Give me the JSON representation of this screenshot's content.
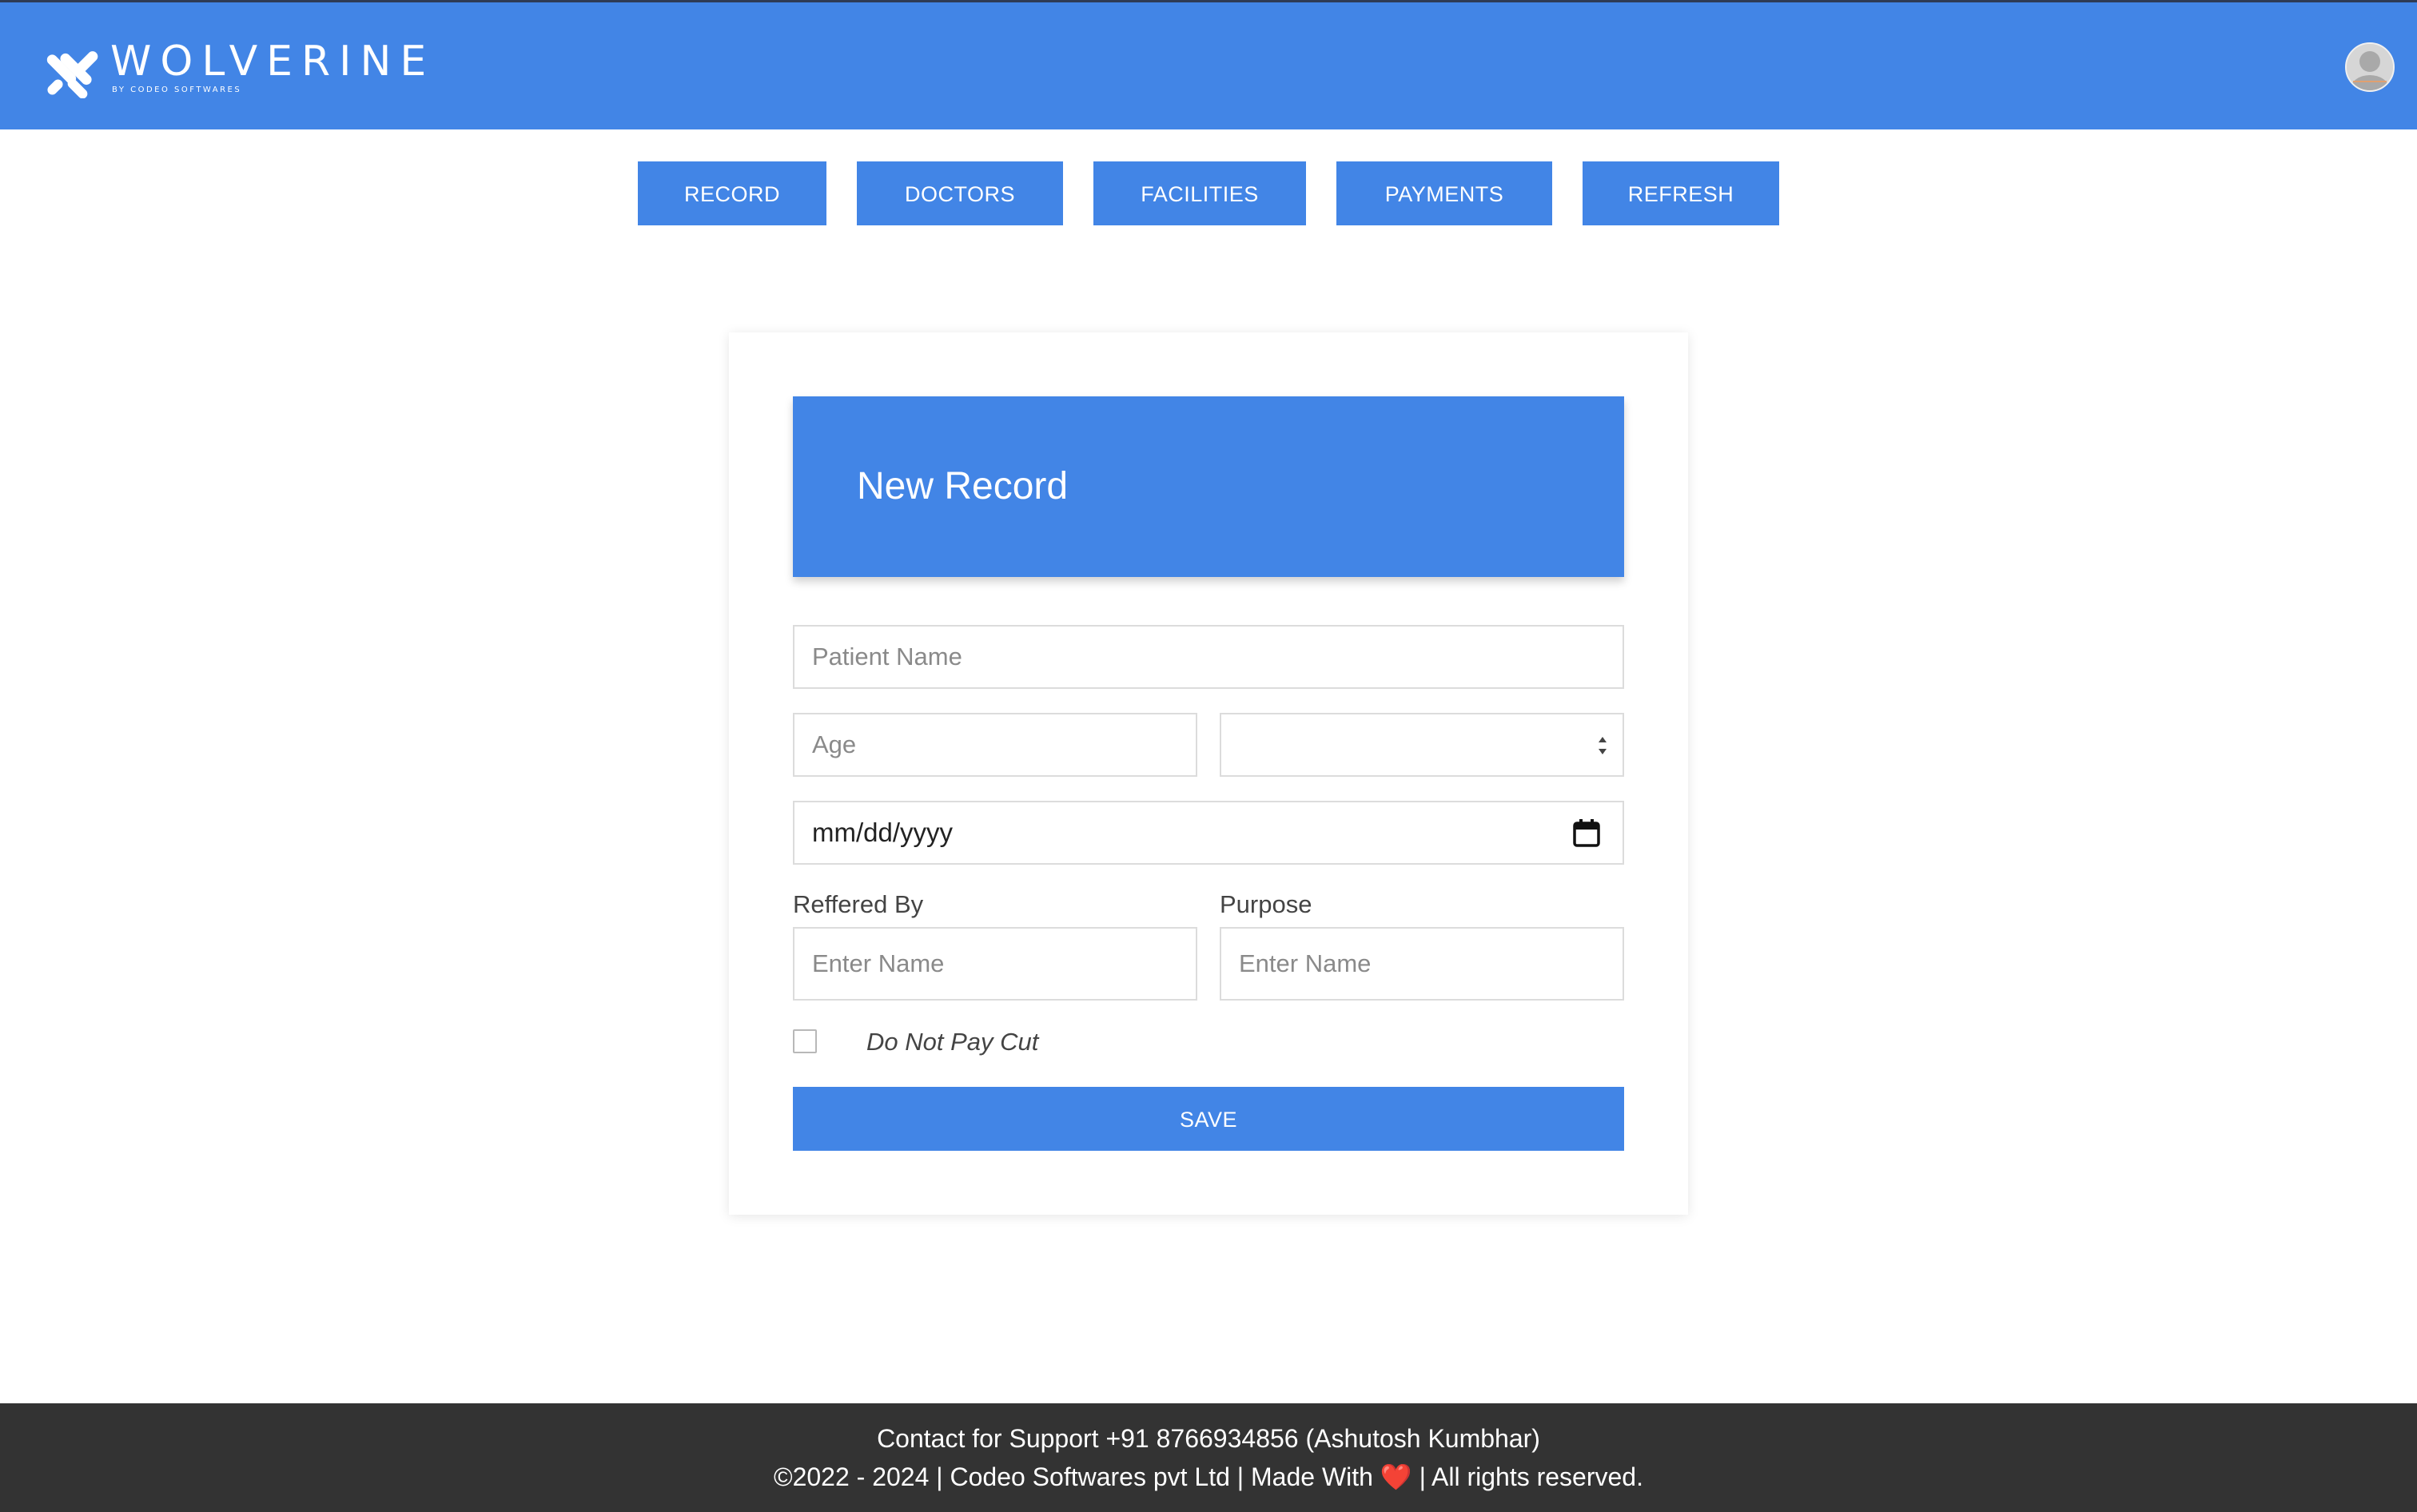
{
  "header": {
    "brand_name": "WOLVERINE",
    "brand_subtitle": "BY CODEO SOFTWARES",
    "logo_icon": "wolverine-claw-logo",
    "avatar_icon": "user-avatar-icon"
  },
  "nav": {
    "items": [
      {
        "label": "RECORD"
      },
      {
        "label": "DOCTORS"
      },
      {
        "label": "FACILITIES"
      },
      {
        "label": "PAYMENTS"
      },
      {
        "label": "REFRESH"
      }
    ]
  },
  "form": {
    "title": "New Record",
    "patient_name": {
      "placeholder": "Patient Name",
      "value": ""
    },
    "age": {
      "placeholder": "Age",
      "value": ""
    },
    "gender_select": {
      "selected": "",
      "icon": "select-arrows-icon"
    },
    "date": {
      "display": "mm/dd/yyyy",
      "icon": "calendar-icon"
    },
    "referred_by": {
      "label": "Reffered By",
      "placeholder": "Enter Name",
      "value": ""
    },
    "purpose": {
      "label": "Purpose",
      "placeholder": "Enter Name",
      "value": ""
    },
    "do_not_pay_cut": {
      "label": "Do Not Pay Cut",
      "checked": false
    },
    "save_label": "SAVE"
  },
  "footer": {
    "support_line": "Contact for Support +91 8766934856 (Ashutosh Kumbhar)",
    "copyright_prefix": "©2022 - 2024 | Codeo Softwares pvt Ltd | Made With",
    "heart_icon": "❤️",
    "copyright_suffix": "| All rights reserved."
  },
  "colors": {
    "primary": "#4285e6",
    "footer_bg": "#333333",
    "heart": "#e0282e"
  }
}
